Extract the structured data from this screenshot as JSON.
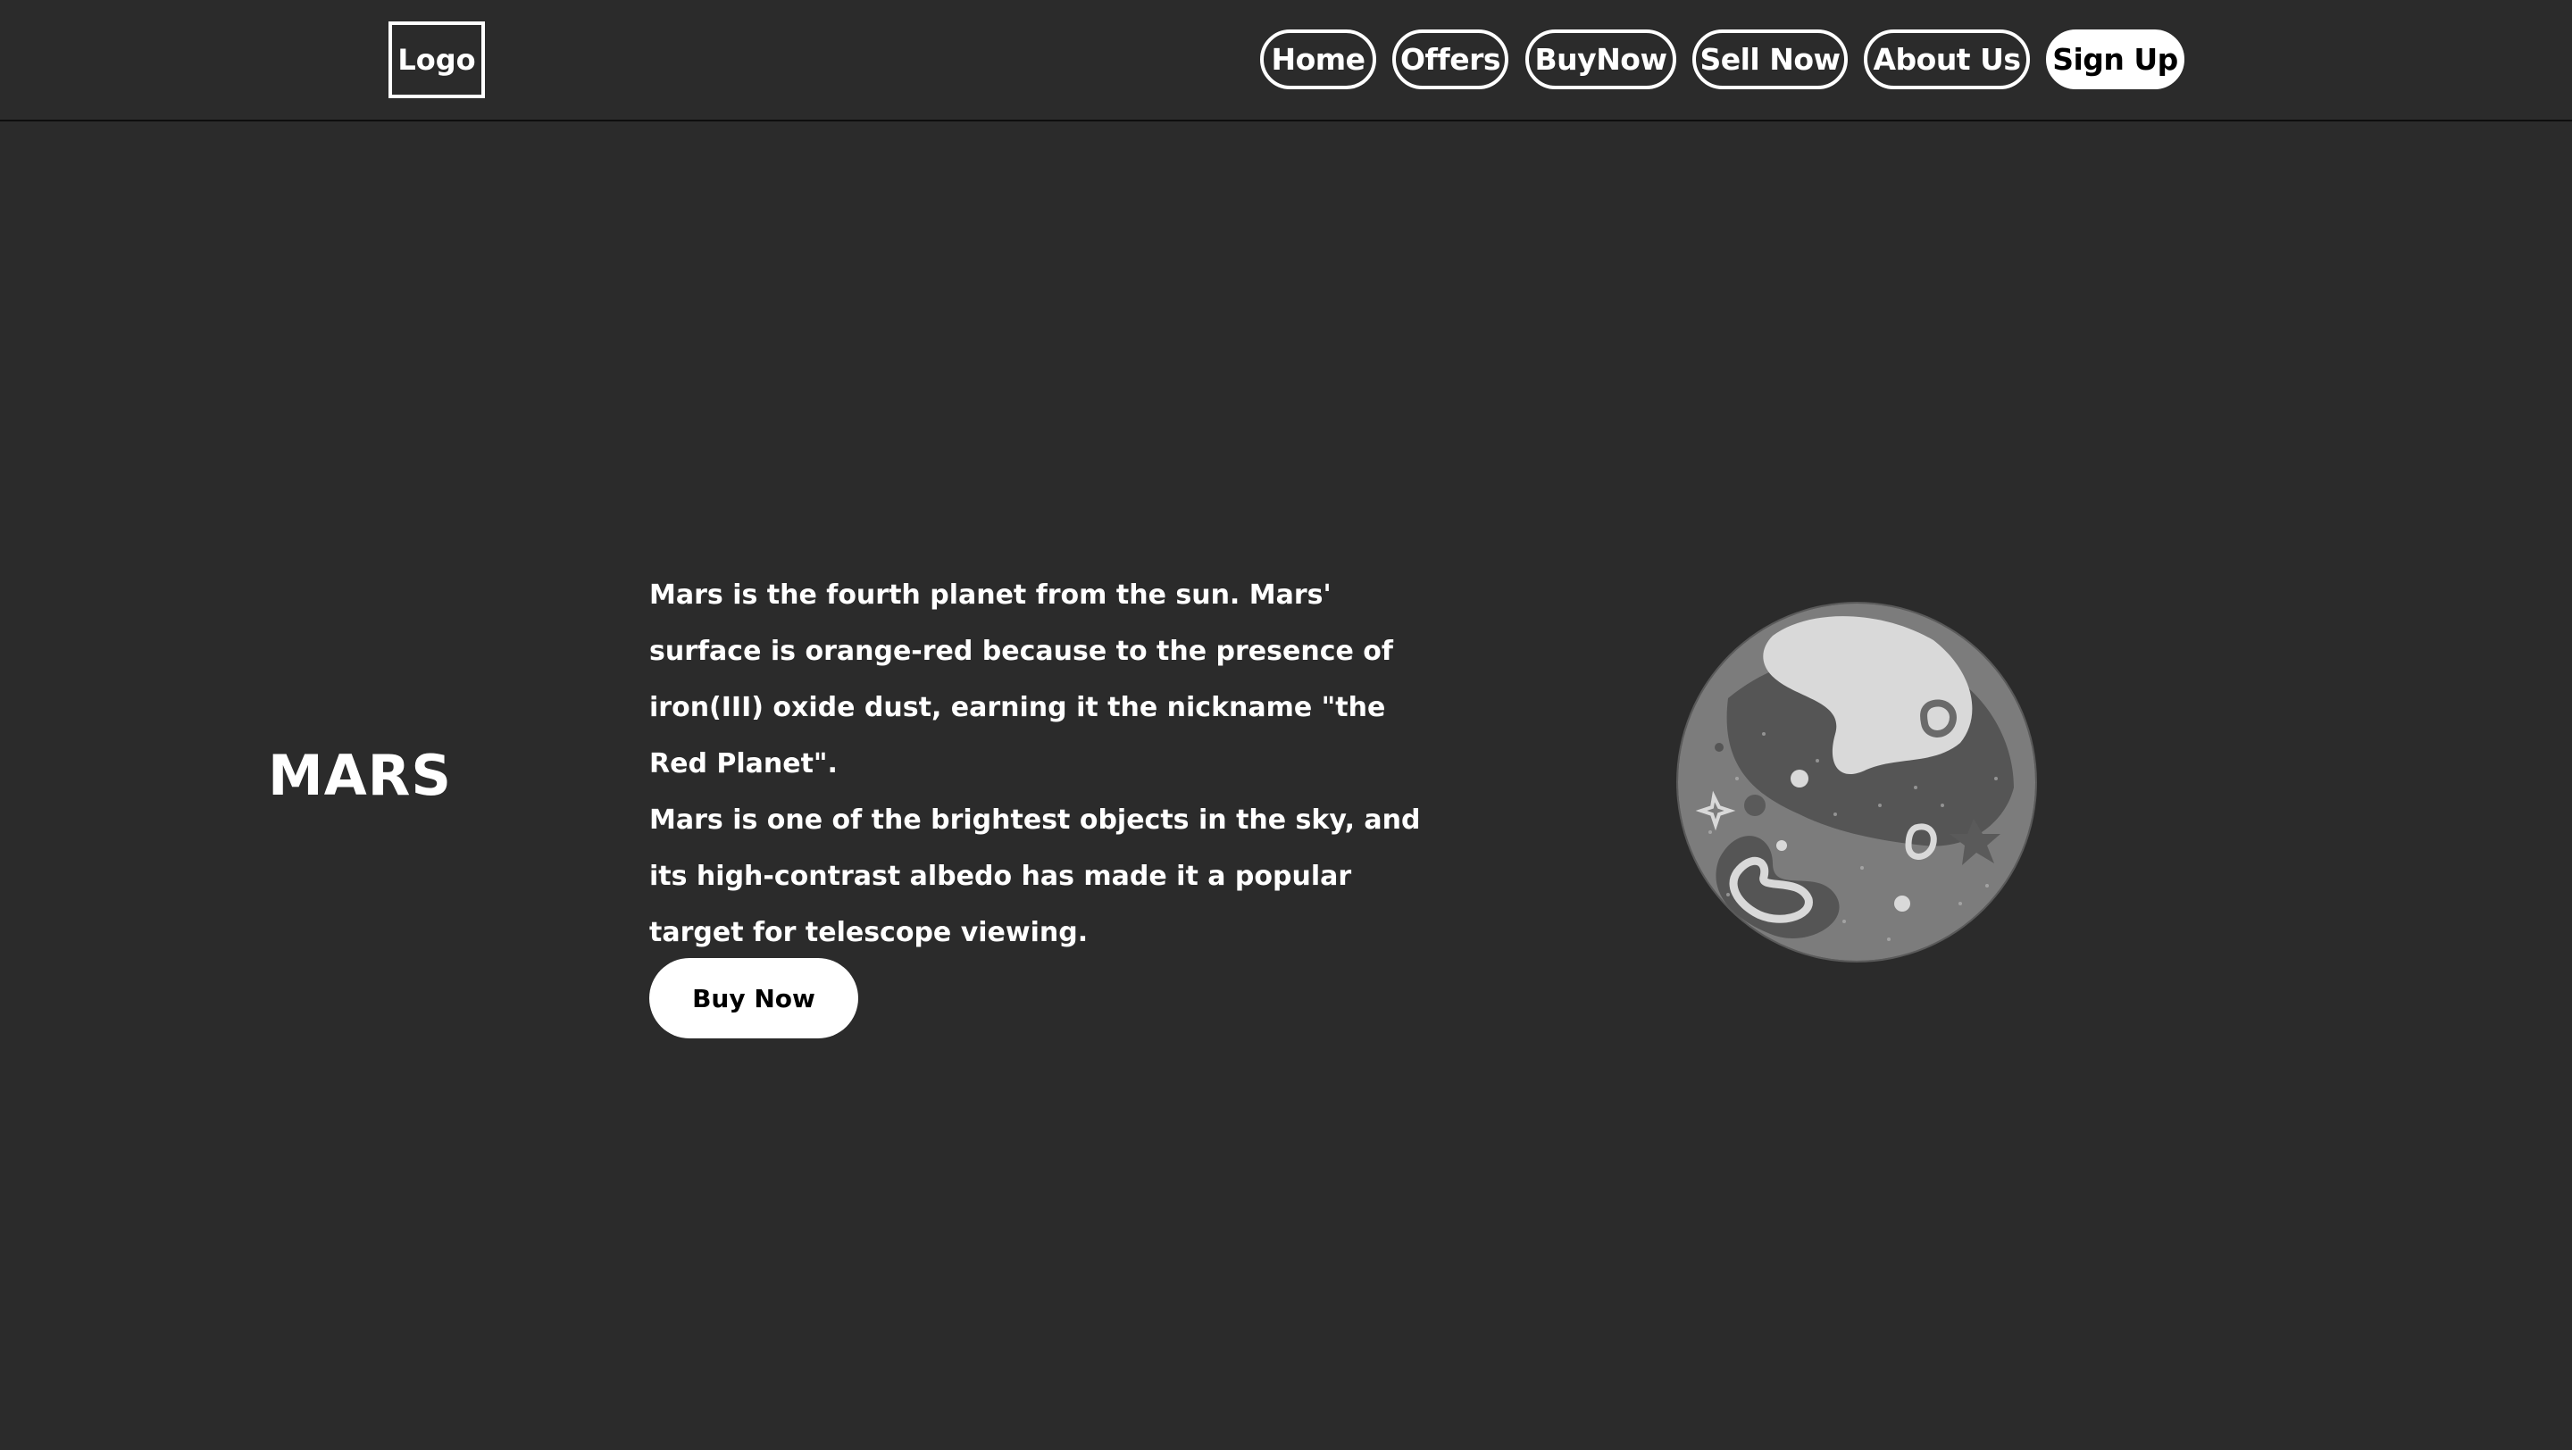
{
  "header": {
    "logo": "Logo",
    "nav": {
      "home": "Home",
      "offers": "Offers",
      "buy_now": "BuyNow",
      "sell_now": "Sell Now",
      "about_us": "About Us",
      "sign_up": "Sign Up"
    }
  },
  "hero": {
    "title": "MARS",
    "paragraph_1": "Mars is the fourth planet from the sun. Mars' surface is orange-red because to the presence of iron(III) oxide dust, earning it the nickname \"the Red Planet\".",
    "paragraph_2": "Mars is one of the brightest objects in the sky, and its high-contrast albedo has made it a popular target for telescope viewing.",
    "buy_button": "Buy Now",
    "image_icon": "mars-planet-illustration"
  },
  "colors": {
    "background": "#2b2b2b",
    "text": "#ffffff",
    "button_fill": "#ffffff",
    "button_text": "#000000"
  }
}
